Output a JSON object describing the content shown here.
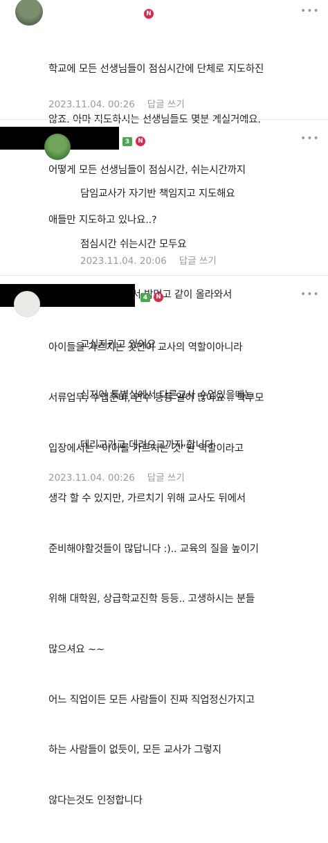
{
  "comments": [
    {
      "level": "",
      "badge": "N",
      "lines": [
        "학교에 모든 선생님들이 점심시간에 단체로 지도하진",
        "않죠. 아마 지도하시는 선생님들도 몇분 계실거예요.",
        "어떻게 모든 선생님들이 점심시간, 쉬는시간까지",
        "애들만 지도하고 있나요..?"
      ],
      "date": "2023.11.04. 00:26",
      "reply": "답글 쓰기"
    },
    {
      "level": "3",
      "badge": "N",
      "lines": [
        "담임교사가 자기반 책임지고 지도해요",
        "점심시간 쉬는시간 모두요",
        "보통 같이 가서 밥먹고 같이 올라와서",
        "교실지키고 있어요",
        "심지어 특별실에서 다른교사 수업있을때는",
        "데리고가고 데려오고까지 합니다"
      ],
      "date": "2023.11.04. 20:06",
      "reply": "답글 쓰기"
    },
    {
      "level": "4",
      "badge": "N",
      "lines": [
        "아이들을 가르치는 것만이 교사의 역할이아니라",
        "서류업무, 수업준비, 연수 등등 일이 많아요 .. 학부모",
        "입장에서는 “아이를 가르치는 것”만 역할이라고",
        "생각 할 수 있지만, 가르치기 위해 교사도 뒤에서",
        "준비해야할것들이 많답니다 :).. 교육의 질을 높이기",
        "위해 대학원, 상급학교진학 등등.. 고생하시는 분들",
        "많으셔요 ~~",
        "어느 직업이든 모든 사람들이 진짜 직업정신가지고",
        "하는 사람들이 없듯이, 모든 교사가 그렇지",
        "않다는것도 인정합니다"
      ],
      "date": "2023.11.04. 00:26",
      "reply": "답글 쓰기"
    }
  ],
  "more_icon": "more-dots-icon"
}
